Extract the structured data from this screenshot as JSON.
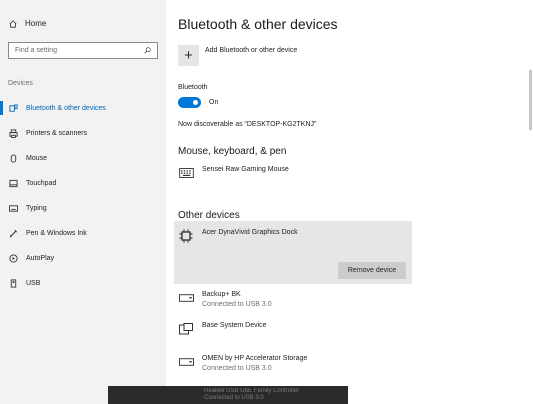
{
  "sidebar": {
    "home_label": "Home",
    "search_placeholder": "Find a setting",
    "section_label": "Devices",
    "items": [
      {
        "label": "Bluetooth & other devices",
        "icon": "bluetooth-icon"
      },
      {
        "label": "Printers & scanners",
        "icon": "printer-icon"
      },
      {
        "label": "Mouse",
        "icon": "mouse-icon"
      },
      {
        "label": "Touchpad",
        "icon": "touchpad-icon"
      },
      {
        "label": "Typing",
        "icon": "keyboard-icon"
      },
      {
        "label": "Pen & Windows Ink",
        "icon": "pen-icon"
      },
      {
        "label": "AutoPlay",
        "icon": "autoplay-icon"
      },
      {
        "label": "USB",
        "icon": "usb-icon"
      }
    ],
    "active_index": 0
  },
  "main": {
    "title": "Bluetooth & other devices",
    "add_device_label": "Add Bluetooth or other device",
    "bluetooth_label": "Bluetooth",
    "bluetooth_state": "On",
    "discoverable_text": "Now discoverable as “DESKTOP-KG2TKNJ”",
    "mouse_section": "Mouse, keyboard, & pen",
    "mouse_device": "Sensei Raw Gaming Mouse",
    "other_section": "Other devices",
    "selected_device": "Acer DynaVivid Graphics Dock",
    "remove_label": "Remove device",
    "other_devices": [
      {
        "name": "Backup+ BK",
        "status": "Connected to USB 3.0",
        "icon": "drive-icon"
      },
      {
        "name": "Base System Device",
        "status": "",
        "icon": "system-device-icon"
      },
      {
        "name": "OMEN by HP Accelerator Storage",
        "status": "Connected to USB 3.0",
        "icon": "drive-icon"
      }
    ],
    "partial_device": "Realtek USB GbE Family Controller",
    "partial_status": "Connected to USB 3.0"
  },
  "colors": {
    "accent": "#0078d7",
    "sidebar_bg": "#f2f2f2",
    "selected_bg": "#e6e6e6"
  }
}
